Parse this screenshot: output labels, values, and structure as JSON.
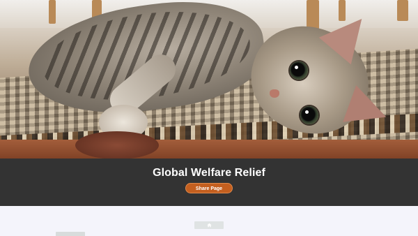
{
  "hero": {
    "image_alt": "cat-photo"
  },
  "banner": {
    "title": "Global Welfare Relief",
    "share_label": "Share Page",
    "background_color": "#333333",
    "button_color": "#c45f1f"
  },
  "nav": {
    "home_icon": "home-icon",
    "tab_icon": "tab"
  }
}
